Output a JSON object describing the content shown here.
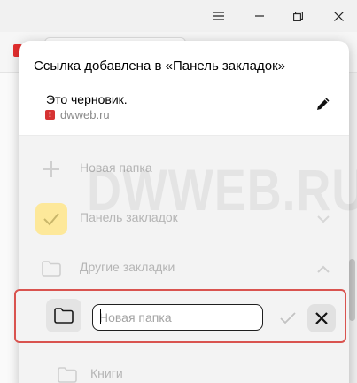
{
  "window": {
    "menu_icon": "hamburger-menu-icon",
    "minimize_icon": "minimize-icon",
    "restore_icon": "restore-icon",
    "close_icon": "close-icon"
  },
  "popup": {
    "title": "Ссылка добавлена в «Панель закладок»",
    "page_name": "Это черновик.",
    "site_url": "dwweb.ru",
    "edit_icon": "pencil-icon"
  },
  "folders": [
    {
      "label": "Новая папка",
      "icon": "plus-icon"
    },
    {
      "label": "Панель закладок",
      "icon": "checkmark-icon"
    },
    {
      "label": "Другие закладки",
      "icon": "folder-icon"
    },
    {
      "label": "Книги",
      "icon": "folder-icon"
    }
  ],
  "new_folder": {
    "input_value": "",
    "input_placeholder": "Новая папка",
    "confirm_icon": "checkmark-icon",
    "cancel_icon": "close-icon"
  },
  "watermark": "DWWEB.RU",
  "colors": {
    "highlight_border": "#d9534f",
    "selected_folder_bg": "#fde89a",
    "favicon": "#d63333"
  }
}
